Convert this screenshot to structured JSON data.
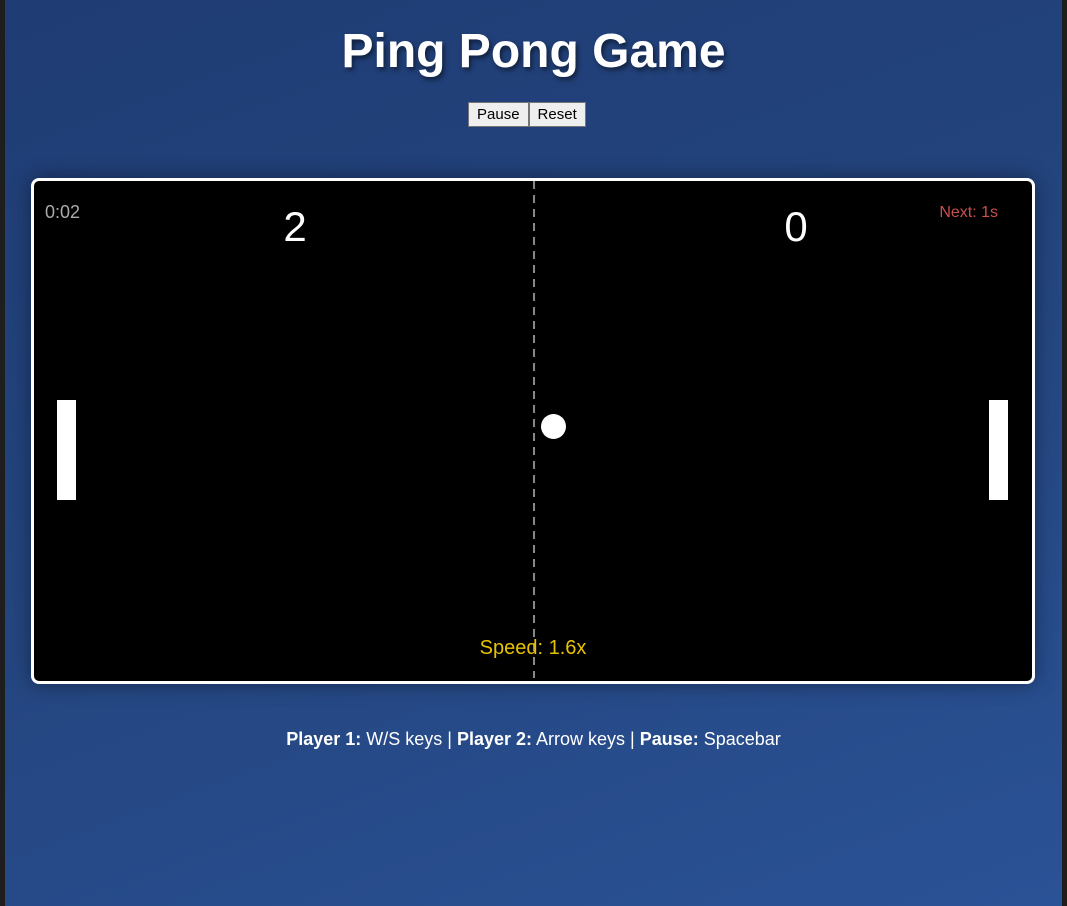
{
  "title": "Ping Pong Game",
  "controls": {
    "pause": "Pause",
    "reset": "Reset"
  },
  "game": {
    "timer": "0:02",
    "score_left": "2",
    "score_right": "0",
    "next": "Next: 1s",
    "speed": "Speed: 1.6x"
  },
  "help": {
    "p1_label": "Player 1:",
    "p1_keys": " W/S keys | ",
    "p2_label": "Player 2:",
    "p2_keys": " Arrow keys | ",
    "pause_label": "Pause:",
    "pause_key": " Spacebar"
  },
  "colors": {
    "speed": "#e6c200",
    "next": "#c94f4f",
    "background": "#24457f"
  }
}
